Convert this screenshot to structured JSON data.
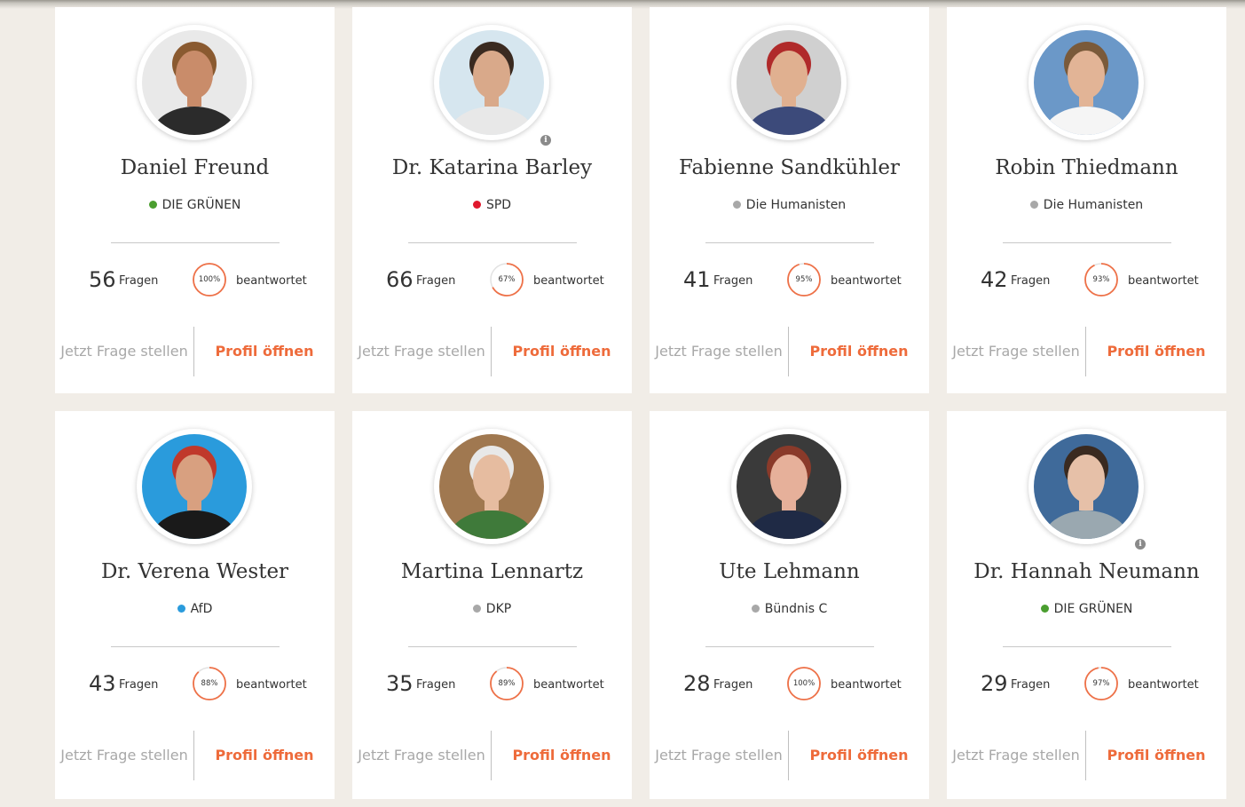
{
  "colors": {
    "accent": "#ee6b3b",
    "ring": "#ee7148",
    "ring_track": "#e2e2e2",
    "page_bg": "#f1ede7"
  },
  "labels": {
    "questions": "Fragen",
    "answered": "beantwortet",
    "ask": "Jetzt Frage stellen",
    "profile": "Profil öffnen"
  },
  "candidates": [
    {
      "name": "Daniel Freund",
      "party": "DIE GRÜNEN",
      "party_color": "#4a9e2f",
      "questions": "56",
      "answered_text": "100%",
      "answered_fraction": 1.0,
      "has_info_icon": false,
      "avatar_icon": "portrait-photo"
    },
    {
      "name": "Dr. Katarina Barley",
      "party": "SPD",
      "party_color": "#e0182d",
      "questions": "66",
      "answered_text": "67%",
      "answered_fraction": 0.67,
      "has_info_icon": true,
      "avatar_icon": "portrait-photo"
    },
    {
      "name": "Fabienne Sandkühler",
      "party": "Die Humanisten",
      "party_color": "#a8a8a8",
      "questions": "41",
      "answered_text": "95%",
      "answered_fraction": 0.95,
      "has_info_icon": false,
      "avatar_icon": "portrait-photo"
    },
    {
      "name": "Robin Thiedmann",
      "party": "Die Humanisten",
      "party_color": "#a8a8a8",
      "questions": "42",
      "answered_text": "93%",
      "answered_fraction": 0.93,
      "has_info_icon": false,
      "avatar_icon": "portrait-photo"
    },
    {
      "name": "Dr. Verena Wester",
      "party": "AfD",
      "party_color": "#2a9bdc",
      "questions": "43",
      "answered_text": "88%",
      "answered_fraction": 0.88,
      "has_info_icon": false,
      "avatar_icon": "campaign-poster-photo"
    },
    {
      "name": "Martina Lennartz",
      "party": "DKP",
      "party_color": "#a8a8a8",
      "questions": "35",
      "answered_text": "89%",
      "answered_fraction": 0.89,
      "has_info_icon": false,
      "avatar_icon": "portrait-photo"
    },
    {
      "name": "Ute Lehmann",
      "party": "Bündnis C",
      "party_color": "#a8a8a8",
      "questions": "28",
      "answered_text": "100%",
      "answered_fraction": 1.0,
      "has_info_icon": false,
      "avatar_icon": "portrait-photo"
    },
    {
      "name": "Dr. Hannah Neumann",
      "party": "DIE GRÜNEN",
      "party_color": "#4a9e2f",
      "questions": "29",
      "answered_text": "97%",
      "answered_fraction": 0.97,
      "has_info_icon": true,
      "avatar_icon": "portrait-photo"
    }
  ]
}
